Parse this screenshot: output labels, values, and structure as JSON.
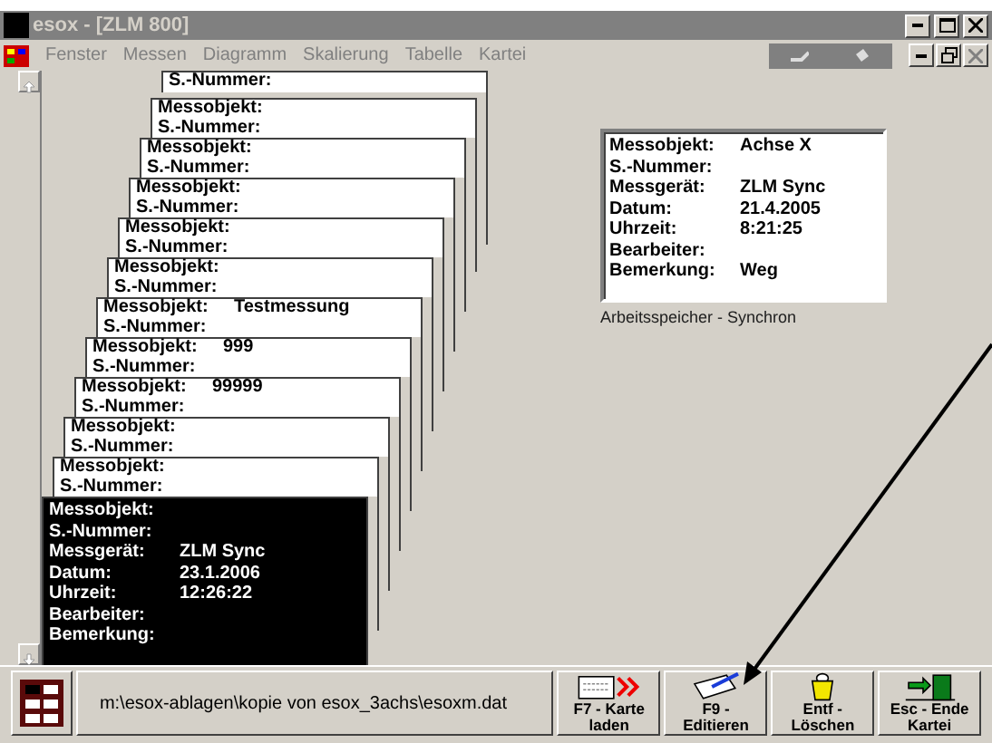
{
  "window": {
    "title": "esox - [ZLM 800]"
  },
  "menu": [
    {
      "label": "Fenster",
      "disabled": true
    },
    {
      "label": "Messen",
      "disabled": true
    },
    {
      "label": "Diagramm",
      "disabled": true
    },
    {
      "label": "Skalierung",
      "disabled": true
    },
    {
      "label": "Tabelle",
      "disabled": true
    },
    {
      "label": "Kartei",
      "disabled": true
    }
  ],
  "cards": [
    {
      "selected": false,
      "lines": [
        {
          "label": "S.-Nummer:"
        }
      ]
    },
    {
      "selected": false,
      "lines": [
        {
          "label": "Messobjekt:"
        },
        {
          "label": "S.-Nummer:"
        }
      ]
    },
    {
      "selected": false,
      "lines": [
        {
          "label": "Messobjekt:"
        },
        {
          "label": "S.-Nummer:"
        }
      ]
    },
    {
      "selected": false,
      "lines": [
        {
          "label": "Messobjekt:"
        },
        {
          "label": "S.-Nummer:"
        }
      ]
    },
    {
      "selected": false,
      "lines": [
        {
          "label": "Messobjekt:"
        },
        {
          "label": "S.-Nummer:"
        }
      ]
    },
    {
      "selected": false,
      "lines": [
        {
          "label": "Messobjekt:"
        },
        {
          "label": "S.-Nummer:"
        }
      ]
    },
    {
      "selected": false,
      "lines": [
        {
          "label": "Messobjekt:",
          "value": "Testmessung"
        },
        {
          "label": "S.-Nummer:"
        }
      ]
    },
    {
      "selected": false,
      "lines": [
        {
          "label": "Messobjekt:",
          "value": "999"
        },
        {
          "label": "S.-Nummer:"
        }
      ]
    },
    {
      "selected": false,
      "lines": [
        {
          "label": "Messobjekt:",
          "value": "99999"
        },
        {
          "label": "S.-Nummer:"
        }
      ]
    },
    {
      "selected": false,
      "lines": [
        {
          "label": "Messobjekt:"
        },
        {
          "label": "S.-Nummer:"
        }
      ]
    },
    {
      "selected": false,
      "lines": [
        {
          "label": "Messobjekt:"
        },
        {
          "label": "S.-Nummer:"
        }
      ]
    },
    {
      "selected": true,
      "lines": [
        {
          "label": "Messobjekt:"
        },
        {
          "label": "S.-Nummer:"
        },
        {
          "label": "Messgerät:",
          "value": "ZLM Sync"
        },
        {
          "label": "Datum:",
          "value": "23.1.2006"
        },
        {
          "label": "Uhrzeit:",
          "value": "12:26:22"
        },
        {
          "label": "Bearbeiter:"
        },
        {
          "label": "Bemerkung:"
        }
      ]
    }
  ],
  "memory_panel": {
    "lines": [
      {
        "label": "Messobjekt:",
        "value": "Achse X"
      },
      {
        "label": "S.-Nummer:"
      },
      {
        "label": "Messgerät:",
        "value": "ZLM Sync"
      },
      {
        "label": "Datum:",
        "value": "21.4.2005"
      },
      {
        "label": "Uhrzeit:",
        "value": "8:21:25"
      },
      {
        "label": "Bearbeiter:"
      },
      {
        "label": "Bemerkung:",
        "value": "Weg"
      }
    ],
    "caption": "Arbeitsspeicher - Synchron"
  },
  "status": {
    "path": "m:\\esox-ablagen\\kopie von esox_3achs\\esoxm.dat"
  },
  "buttons": [
    {
      "kind": "load",
      "lines": [
        "F7 - Karte",
        "laden"
      ]
    },
    {
      "kind": "edit",
      "lines": [
        "F9 -",
        "Editieren"
      ]
    },
    {
      "kind": "delete",
      "lines": [
        "Entf -",
        "Löschen"
      ]
    },
    {
      "kind": "exit",
      "lines": [
        "Esc - Ende",
        "Kartei"
      ]
    }
  ]
}
